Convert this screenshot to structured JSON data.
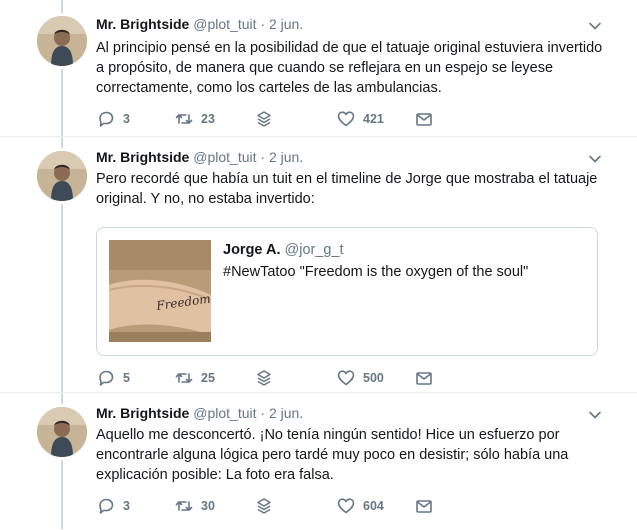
{
  "tweets": [
    {
      "author_name": "Mr. Brightside",
      "author_handle": "@plot_tuit",
      "separator": "·",
      "date": "2 jun.",
      "text": "Al principio pensé en la posibilidad de que el tatuaje original estuviera invertido a propósito, de manera que cuando se reflejara en un espejo se leyese correctamente, como los carteles de las ambulancias.",
      "replies": "3",
      "retweets": "23",
      "likes": "421"
    },
    {
      "author_name": "Mr. Brightside",
      "author_handle": "@plot_tuit",
      "separator": "·",
      "date": "2 jun.",
      "text": "Pero recordé que había un tuit en el timeline de Jorge que mostraba el tatuaje original. Y no, no estaba invertido:",
      "quote": {
        "author_name": "Jorge A.",
        "author_handle": "@jor_g_t",
        "text": "#NewTatoo \"Freedom is the oxygen of the soul\"",
        "image_tattoo_text": "Freedom"
      },
      "replies": "5",
      "retweets": "25",
      "likes": "500"
    },
    {
      "author_name": "Mr. Brightside",
      "author_handle": "@plot_tuit",
      "separator": "·",
      "date": "2 jun.",
      "text": "Aquello me desconcertó. ¡No tenía ningún sentido! Hice un esfuerzo por encontrarle alguna lógica pero tardé muy poco en desistir; sólo había una explicación posible: La foto era falsa.",
      "replies": "3",
      "retweets": "30",
      "likes": "604"
    }
  ],
  "icons": {
    "reply": "reply-icon",
    "retweet": "retweet-icon",
    "stack": "stack-icon",
    "like": "heart-icon",
    "dm": "envelope-icon",
    "menu": "chevron-down-icon"
  },
  "colors": {
    "text": "#14171a",
    "muted": "#657786",
    "border": "#e6ecf0",
    "thread_line": "#cfd9de"
  }
}
